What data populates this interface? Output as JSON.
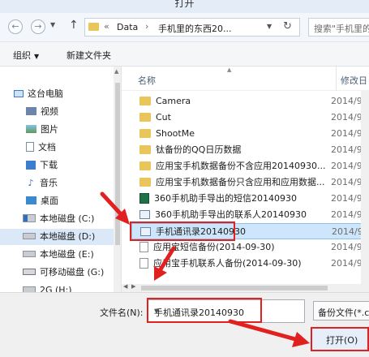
{
  "window": {
    "title": "打开"
  },
  "nav": {
    "back_icon": "back-arrow-icon",
    "forward_icon": "forward-arrow-icon",
    "up_icon": "up-arrow-icon",
    "path_sep0": "«",
    "breadcrumb": [
      "Data",
      "手机里的东西20..."
    ],
    "path_sep1": "›",
    "refresh_icon": "refresh-icon",
    "search_placeholder": "搜索\"手机里的"
  },
  "toolbar": {
    "organize": "组织",
    "new_folder": "新建文件夹"
  },
  "sidebar": {
    "items": [
      {
        "label": "这台电脑",
        "icon": "pc-icon",
        "selected": false
      },
      {
        "label": "视频",
        "icon": "video-folder-icon",
        "selected": false
      },
      {
        "label": "图片",
        "icon": "pictures-folder-icon",
        "selected": false
      },
      {
        "label": "文档",
        "icon": "documents-folder-icon",
        "selected": false
      },
      {
        "label": "下载",
        "icon": "downloads-folder-icon",
        "selected": false
      },
      {
        "label": "音乐",
        "icon": "music-folder-icon",
        "selected": false
      },
      {
        "label": "桌面",
        "icon": "desktop-folder-icon",
        "selected": false
      },
      {
        "label": "本地磁盘 (C:)",
        "icon": "system-drive-icon",
        "selected": false
      },
      {
        "label": "本地磁盘 (D:)",
        "icon": "drive-icon",
        "selected": true
      },
      {
        "label": "本地磁盘 (E:)",
        "icon": "drive-icon",
        "selected": false
      },
      {
        "label": "可移动磁盘 (G:)",
        "icon": "usb-drive-icon",
        "selected": false
      },
      {
        "label": "2G (H:)",
        "icon": "drive-icon",
        "selected": false
      }
    ]
  },
  "columns": {
    "name": "名称",
    "date": "修改日"
  },
  "files": [
    {
      "name": "Camera",
      "date": "2014/9/",
      "type": "folder",
      "selected": false
    },
    {
      "name": "Cut",
      "date": "2014/9/",
      "type": "folder",
      "selected": false
    },
    {
      "name": "ShootMe",
      "date": "2014/9/",
      "type": "folder",
      "selected": false
    },
    {
      "name": "钛备份的QQ日历数据",
      "date": "2014/9/",
      "type": "folder",
      "selected": false
    },
    {
      "name": "应用宝手机数据备份不含应用20140930...",
      "date": "2014/9/",
      "type": "folder",
      "selected": false
    },
    {
      "name": "应用宝手机数据备份只含应用和应用数据...",
      "date": "2014/9/",
      "type": "folder",
      "selected": false
    },
    {
      "name": "360手机助手导出的短信20140930",
      "date": "2014/9/",
      "type": "excel",
      "selected": false
    },
    {
      "name": "360手机助手导出的联系人20140930",
      "date": "2014/9/",
      "type": "contacts",
      "selected": false
    },
    {
      "name": "手机通讯录20140930",
      "date": "2014/9/",
      "type": "contacts",
      "selected": true
    },
    {
      "name": "应用宝短信备份(2014-09-30)",
      "date": "2014/9/",
      "type": "file",
      "selected": false
    },
    {
      "name": "应用宝手机联系人备份(2014-09-30)",
      "date": "2014/9/",
      "type": "file",
      "selected": false
    }
  ],
  "bottom": {
    "filename_label": "文件名(N):",
    "filename_value": "手机通讯录20140930",
    "filetype": "备份文件(*.c",
    "open_button": "打开(O)"
  },
  "colors": {
    "annotation_red": "#e1211f",
    "selection_bg": "#cde6fb",
    "folder_yellow": "#e9c55a"
  }
}
